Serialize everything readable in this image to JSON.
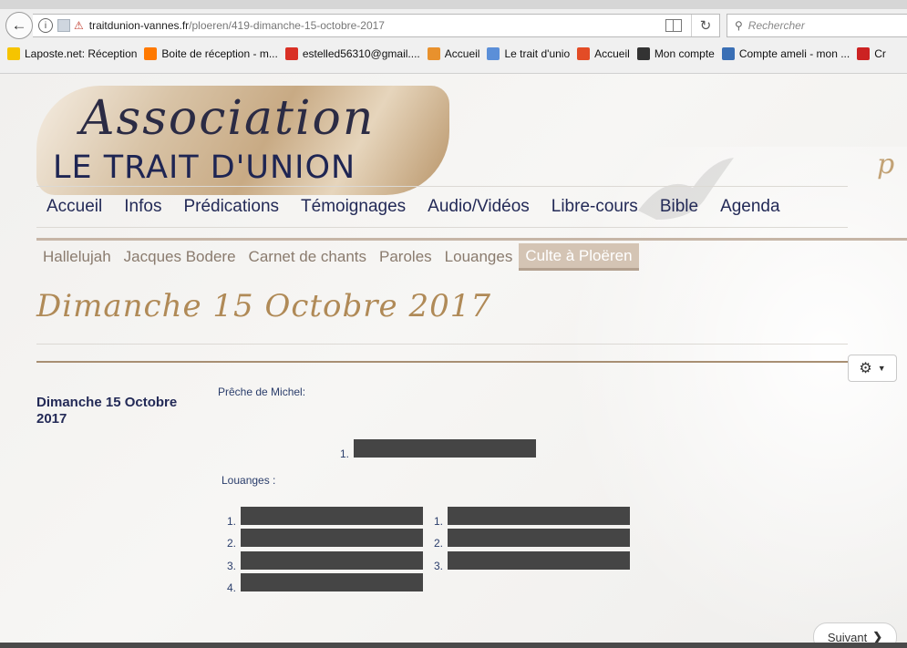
{
  "browser": {
    "url_domain": "traitdunion-vannes.fr",
    "url_path": "/ploeren/419-dimanche-15-octobre-2017",
    "search_placeholder": "Rechercher",
    "bookmarks": [
      {
        "label": "Laposte.net: Réception",
        "color": "#f6c400"
      },
      {
        "label": "Boite de réception - m...",
        "color": "#ff7900"
      },
      {
        "label": "estelled56310@gmail....",
        "color": "#d93025"
      },
      {
        "label": "Accueil",
        "color": "#e8912d"
      },
      {
        "label": "Le trait d'unio",
        "color": "#5b8fd8"
      },
      {
        "label": "Accueil",
        "color": "#e34c26"
      },
      {
        "label": "Mon compte",
        "color": "#333333"
      },
      {
        "label": "Compte ameli - mon ...",
        "color": "#3a6fb5"
      },
      {
        "label": "Cr",
        "color": "#cc2222"
      }
    ]
  },
  "logo": {
    "script": "Association",
    "name": "LE TRAIT D'UNION"
  },
  "right_script": "p",
  "nav": {
    "main": [
      "Accueil",
      "Infos",
      "Prédications",
      "Témoignages",
      "Audio/Vidéos",
      "Libre-cours",
      "Bible",
      "Agenda"
    ],
    "sub": [
      "Hallelujah",
      "Jacques Bodere",
      "Carnet de chants",
      "Paroles",
      "Louanges",
      "Culte à Ploëren"
    ],
    "active_sub": 5
  },
  "page": {
    "title": "Dimanche 15 Octobre 2017",
    "side_title": "Dimanche 15 Octobre 2017",
    "preche_label": "Prêche de Michel:",
    "louanges_label": "Louanges :",
    "preche_items": [
      "1."
    ],
    "louanges_col1": [
      "1.",
      "2.",
      "3.",
      "4."
    ],
    "louanges_col2": [
      "1.",
      "2.",
      "3."
    ],
    "next_label": "Suivant"
  }
}
